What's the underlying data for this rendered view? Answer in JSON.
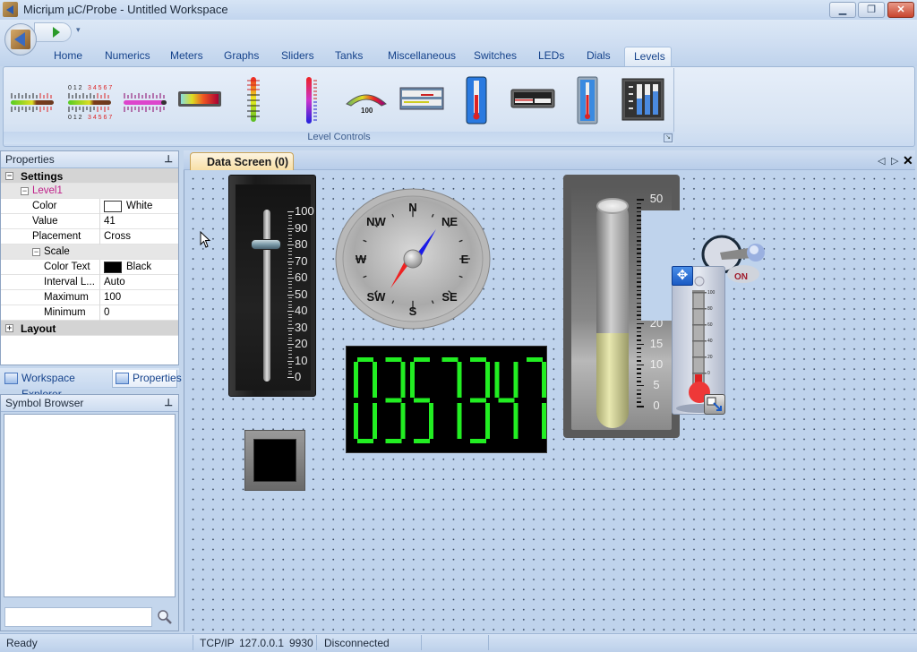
{
  "window": {
    "title": "Micriµm µC/Probe - Untitled Workspace",
    "controls": {
      "minimize": "minimize",
      "restore": "restore",
      "close": "close"
    }
  },
  "quick_access": {
    "run_icon": "play-icon",
    "customize_icon": "dropdown-icon"
  },
  "ribbon": {
    "tabs": [
      {
        "label": "Home",
        "active": false
      },
      {
        "label": "Numerics",
        "active": false
      },
      {
        "label": "Meters",
        "active": false
      },
      {
        "label": "Graphs",
        "active": false
      },
      {
        "label": "Sliders",
        "active": false
      },
      {
        "label": "Tanks",
        "active": false
      },
      {
        "label": "Miscellaneous",
        "active": false
      },
      {
        "label": "Switches",
        "active": false
      },
      {
        "label": "LEDs",
        "active": false
      },
      {
        "label": "Dials",
        "active": false
      },
      {
        "label": "Levels",
        "active": true
      }
    ],
    "group_label": "Level Controls",
    "controls": [
      "horizontal-level-bar-icon",
      "horizontal-level-bar-scaled-icon",
      "horizontal-level-bar-magenta-icon",
      "gradient-level-block-icon",
      "vertical-level-bar-icon",
      "vertical-level-bar-rainbow-icon",
      "arc-level-gauge-icon",
      "dual-level-panel-icon",
      "thermometer-blue-icon",
      "horizontal-level-panel-icon",
      "thermometer-panel-icon",
      "multi-column-level-icon"
    ],
    "arc_gauge_label": "100",
    "scale_digits": "0 1 2 3 4 5 6 7"
  },
  "properties_panel": {
    "title": "Properties",
    "categories": [
      {
        "label": "Settings",
        "expanded": true
      },
      {
        "label": "Layout",
        "expanded": false
      }
    ],
    "object_name": "Level1",
    "rows": [
      {
        "key": "Color",
        "value": "White",
        "swatch": "#ffffff"
      },
      {
        "key": "Value",
        "value": "41"
      },
      {
        "key": "Placement",
        "value": "Cross"
      }
    ],
    "scale": {
      "label": "Scale",
      "rows": [
        {
          "key": "Color Text",
          "value": "Black",
          "swatch": "#000000"
        },
        {
          "key": "Interval L...",
          "value": "Auto"
        },
        {
          "key": "Maximum",
          "value": "100"
        },
        {
          "key": "Minimum",
          "value": "0"
        }
      ]
    }
  },
  "panel_tabs": [
    {
      "label": "Workspace Explorer",
      "active": false
    },
    {
      "label": "Properties",
      "active": true
    }
  ],
  "symbol_browser": {
    "title": "Symbol Browser",
    "search_value": "",
    "search_placeholder": ""
  },
  "document": {
    "tab_label": "Data Screen (0)",
    "nav_prev": "◁",
    "nav_next": "▷",
    "close": "✕"
  },
  "widgets": {
    "slider": {
      "scale": [
        "100",
        "90",
        "80",
        "70",
        "60",
        "50",
        "40",
        "30",
        "20",
        "10",
        "0"
      ],
      "value": 80,
      "min": 0,
      "max": 100
    },
    "compass": {
      "labels": [
        "N",
        "NE",
        "E",
        "SE",
        "S",
        "SW",
        "W",
        "NW"
      ],
      "heading": "NE"
    },
    "seven_segment": {
      "display": "0.35.73.47",
      "color": "#22ee22"
    },
    "tube": {
      "scale": [
        "50",
        "20",
        "15",
        "10",
        "5",
        "0"
      ],
      "value": 20,
      "min": 0,
      "max": 50
    },
    "toggle": {
      "state_label": "ON"
    },
    "thermometer": {
      "scale": [
        "100",
        "80",
        "60",
        "40",
        "20",
        "0"
      ],
      "value": 0
    }
  },
  "status_bar": {
    "status": "Ready",
    "protocol": "TCP/IP",
    "address": "127.0.0.1",
    "port": "9930",
    "connection": "Disconnected"
  }
}
